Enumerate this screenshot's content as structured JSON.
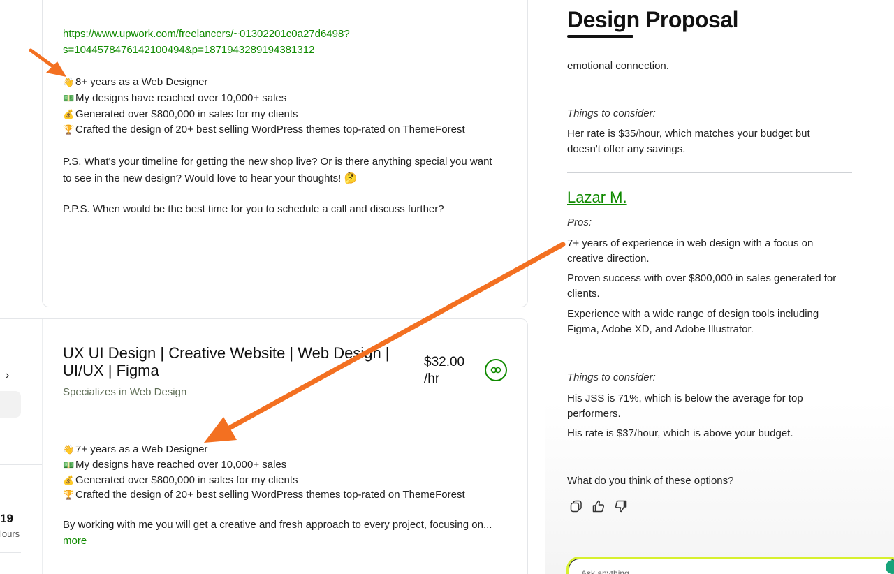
{
  "left": {
    "prev_card": {
      "link_line1": "https://www.upwork.com/freelancers/~01302201c0a27d6498?",
      "link_line2": "s=1044578476142100494&p=1871943289194381312",
      "bullets": [
        {
          "emoji": "👋",
          "text": "8+ years as a Web Designer"
        },
        {
          "emoji": "💵",
          "text": "My designs have reached over 10,000+ sales"
        },
        {
          "emoji": "💰",
          "text": "Generated over $800,000 in sales for my clients"
        },
        {
          "emoji": "🏆",
          "text": "Crafted the design of 20+ best selling WordPress themes top-rated on ThemeForest"
        }
      ],
      "ps_line1": "P.S. What's your timeline for getting the new shop live? Or is there anything special you want",
      "ps_line2": "to see in the new design? Would love to hear your thoughts! 🤔",
      "pps": "P.P.S. When would be the best time for you to schedule a call and discuss further?"
    },
    "card": {
      "title_line1": "UX UI Design | Creative Website | Web Design |",
      "title_line2": "UI/UX | Figma",
      "subtitle": "Specializes in Web Design",
      "price_line1": "$32.00",
      "price_line2": "/hr",
      "bullets": [
        {
          "emoji": "👋",
          "text": "7+ years as a Web Designer"
        },
        {
          "emoji": "💵",
          "text": "My designs have reached over 10,000+ sales"
        },
        {
          "emoji": "💰",
          "text": "Generated over $800,000 in sales for my clients"
        },
        {
          "emoji": "🏆",
          "text": "Crafted the design of 20+ best selling WordPress themes top-rated on ThemeForest"
        }
      ],
      "description": "By working with me you will get a creative and fresh approach to every project, focusing on...",
      "more": "more"
    },
    "strip": {
      "chevron": "›",
      "number": "19",
      "label": "lours"
    }
  },
  "right": {
    "title": "Design Proposal",
    "cut_text": "emotional connection.",
    "section1": {
      "heading": "Things to consider:",
      "text": "Her rate is $35/hour, which matches your budget but doesn't offer any savings."
    },
    "candidate": {
      "name": "Lazar M.",
      "pros_heading": "Pros:",
      "pros": [
        "7+ years of experience in web design with a focus on creative direction.",
        "Proven success with over $800,000 in sales generated for clients.",
        "Experience with a wide range of design tools including Figma, Adobe XD, and Adobe Illustrator."
      ],
      "cons_heading": "Things to consider:",
      "cons": [
        "His JSS is 71%, which is below the average for top performers.",
        "His rate is $37/hour, which is above your budget."
      ]
    },
    "question": "What do you think of these options?",
    "input_placeholder": "Ask anything"
  },
  "colors": {
    "brand_green": "#108a00",
    "arrow_orange": "#f37021",
    "ask_border": "#d7f02f"
  }
}
